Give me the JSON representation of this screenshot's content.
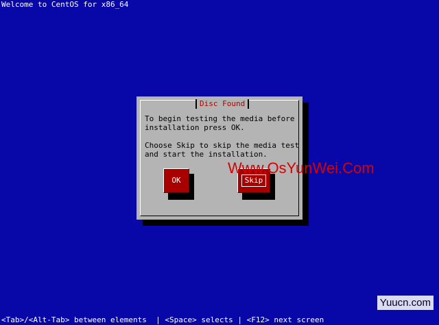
{
  "window": {
    "title": "Welcome to CentOS for x86_64"
  },
  "dialog": {
    "title": "Disc Found",
    "message_lines": [
      "To begin testing the media before",
      "installation press OK.",
      "",
      "Choose Skip to skip the media test",
      "and start the installation."
    ],
    "buttons": {
      "ok_label": "OK",
      "skip_label": "Skip"
    }
  },
  "watermark": {
    "text": "Www.OsYunWei.Com"
  },
  "corner_watermark": {
    "text": "Yuucn.com"
  },
  "help_bar": {
    "text": "<Tab>/<Alt-Tab> between elements  | <Space> selects | <F12> next screen"
  },
  "colors": {
    "background": "#0808a8",
    "dialog": "#b4b4b4",
    "button": "#a80000",
    "title": "#b00000"
  }
}
